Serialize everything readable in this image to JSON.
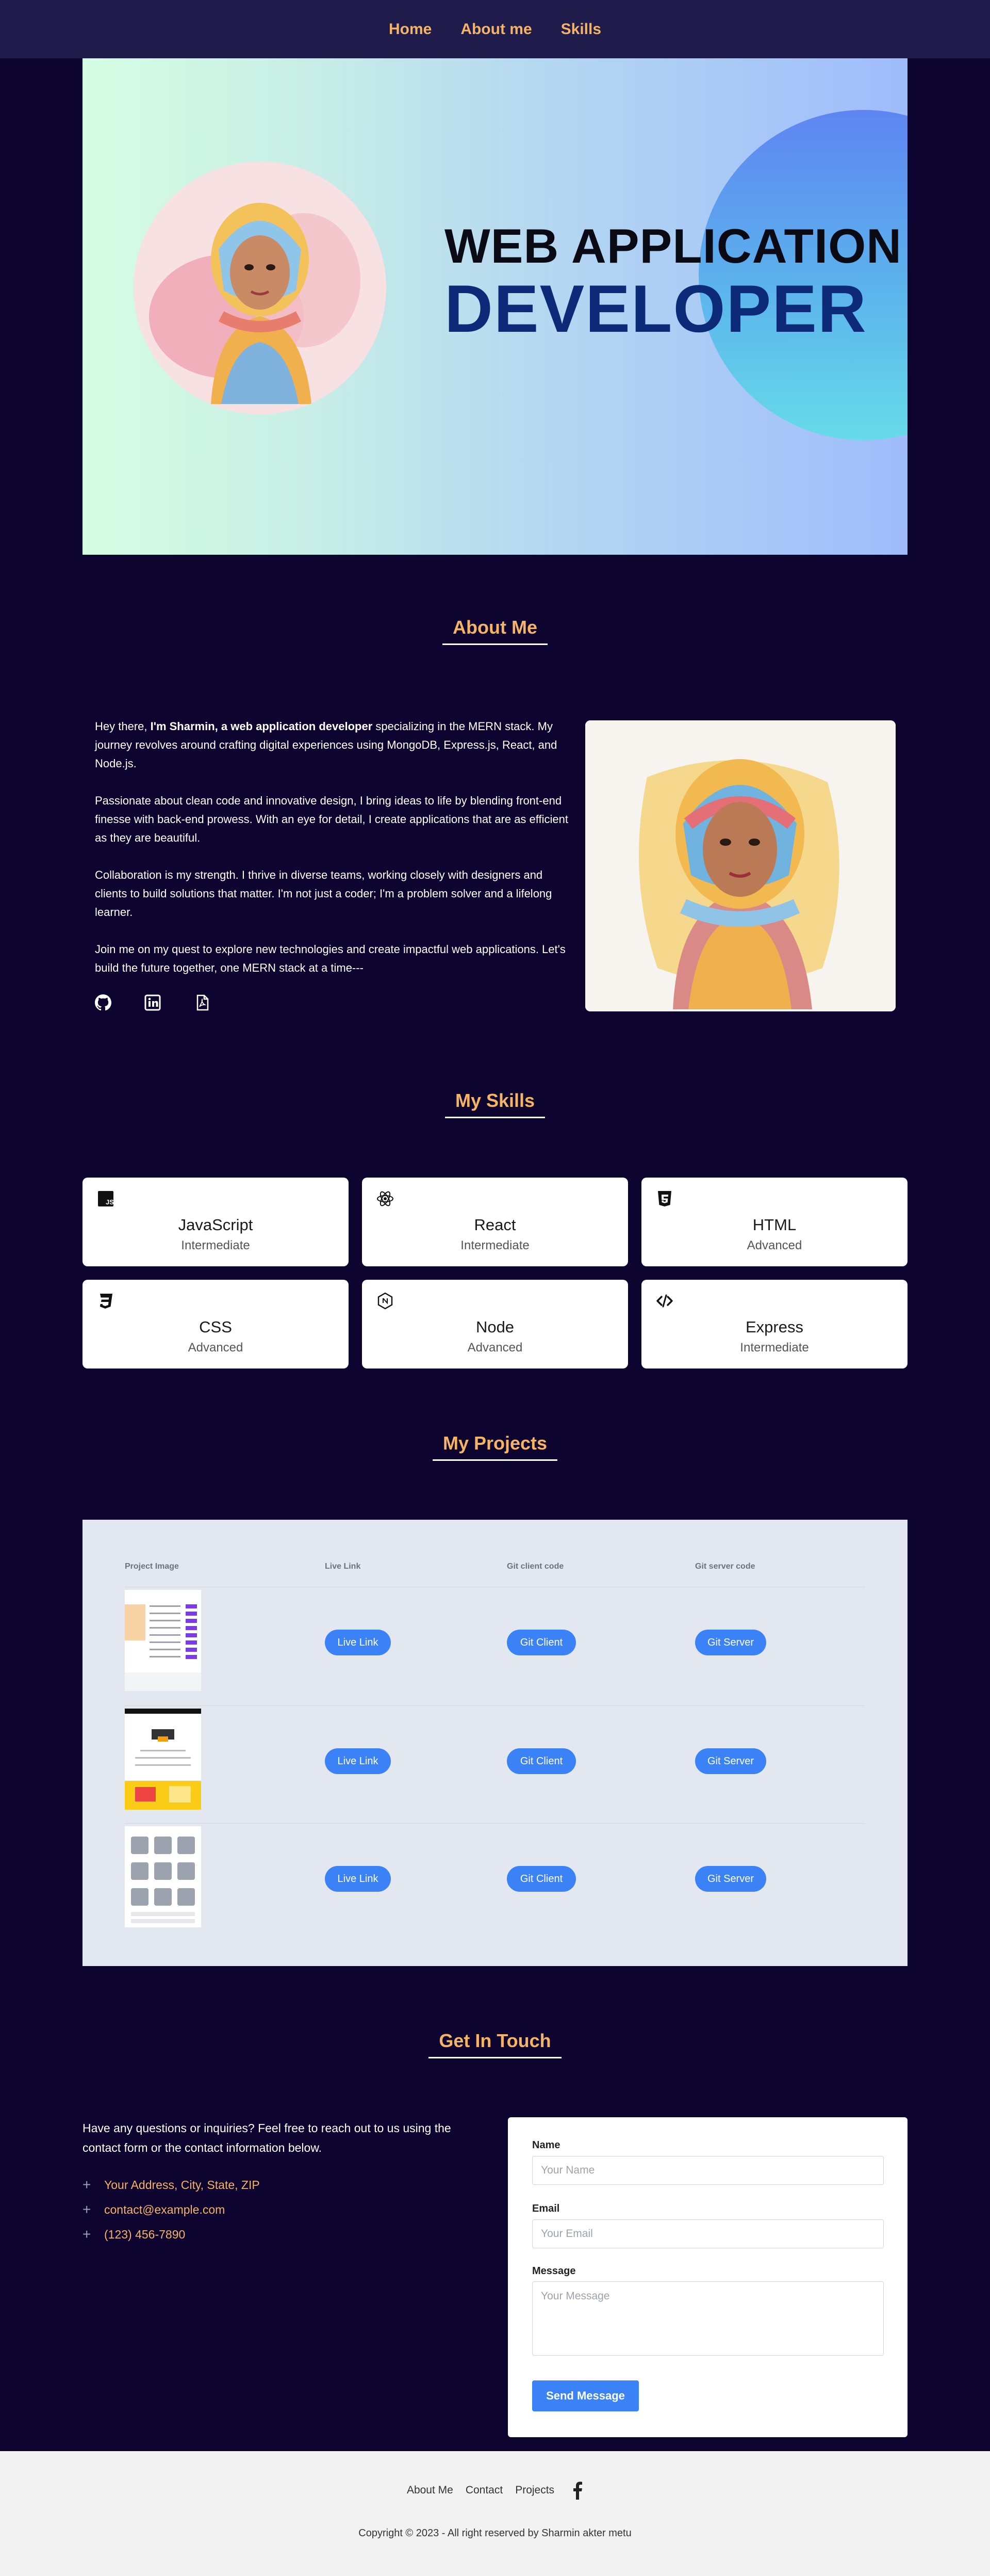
{
  "nav": {
    "items": [
      "Home",
      "About me",
      "Skills"
    ]
  },
  "hero": {
    "line1": "WEB APPLICATION",
    "line2": "DEVELOPER"
  },
  "about": {
    "title": "About Me",
    "p1_pre": "Hey there, ",
    "p1_bold": "I'm Sharmin, a web application developer",
    "p1_post": " specializing in the MERN stack. My journey revolves around crafting digital experiences using MongoDB, Express.js, React, and Node.js.",
    "p2": "Passionate about clean code and innovative design, I bring ideas to life by blending front-end finesse with back-end prowess. With an eye for detail, I create applications that are as efficient as they are beautiful.",
    "p3": "Collaboration is my strength. I thrive in diverse teams, working closely with designers and clients to build solutions that matter. I'm not just a coder; I'm a problem solver and a lifelong learner.",
    "p4": "Join me on my quest to explore new technologies and create impactful web applications. Let's build the future together, one MERN stack at a time---",
    "icons": [
      "github-icon",
      "linkedin-icon",
      "pdf-icon"
    ]
  },
  "skills": {
    "title": "My Skills",
    "items": [
      {
        "name": "JavaScript",
        "level": "Intermediate",
        "icon": "javascript-icon"
      },
      {
        "name": "React",
        "level": "Intermediate",
        "icon": "react-icon"
      },
      {
        "name": "HTML",
        "level": "Advanced",
        "icon": "html5-icon"
      },
      {
        "name": "CSS",
        "level": "Advanced",
        "icon": "css3-icon"
      },
      {
        "name": "Node",
        "level": "Advanced",
        "icon": "nodejs-icon"
      },
      {
        "name": "Express",
        "level": "Intermediate",
        "icon": "code-icon"
      }
    ]
  },
  "projects": {
    "title": "My Projects",
    "headers": [
      "Project Image",
      "Live Link",
      "Git client code",
      "Git server code"
    ],
    "rows": [
      {
        "live": "Live Link",
        "client": "Git Client",
        "server": "Git Server"
      },
      {
        "live": "Live Link",
        "client": "Git Client",
        "server": "Git Server"
      },
      {
        "live": "Live Link",
        "client": "Git Client",
        "server": "Git Server"
      }
    ]
  },
  "contact": {
    "title": "Get In Touch",
    "intro": "Have any questions or inquiries? Feel free to reach out to us using the contact form or the contact information below.",
    "address": "Your Address, City, State, ZIP",
    "email": "contact@example.com",
    "phone": "(123) 456-7890",
    "form": {
      "name_label": "Name",
      "name_placeholder": "Your Name",
      "email_label": "Email",
      "email_placeholder": "Your Email",
      "message_label": "Message",
      "message_placeholder": "Your Message",
      "submit": "Send Message"
    }
  },
  "footer": {
    "links": [
      "About Me",
      "Contact",
      "Projects"
    ],
    "social_icon": "facebook-icon",
    "copyright": "Copyright © 2023 - All right reserved by Sharmin akter metu"
  },
  "colors": {
    "accent": "#f5b366",
    "background": "#0d0430",
    "button": "#3b82f6",
    "nav": "#1f1b4b"
  }
}
